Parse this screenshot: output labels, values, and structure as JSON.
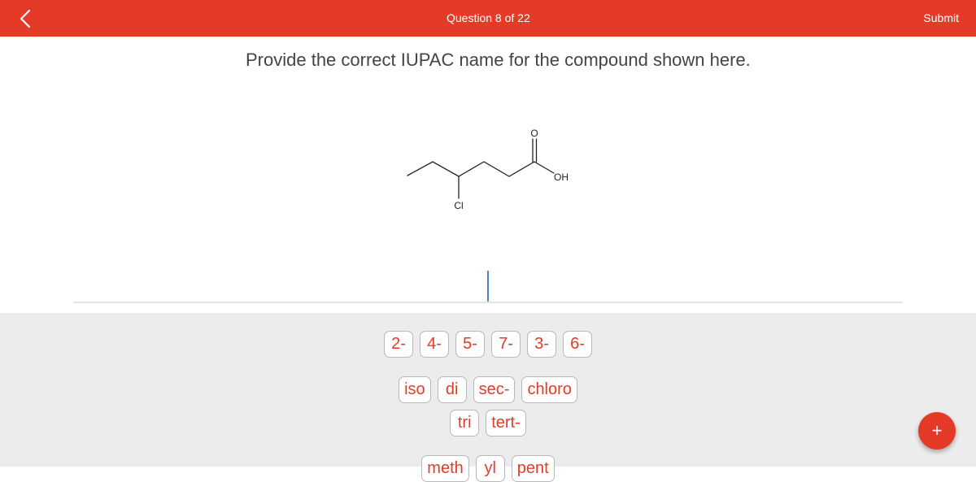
{
  "header": {
    "back_icon": "chevron-left-icon",
    "title": "Question 8 of 22",
    "submit_label": "Submit",
    "color": "#e53a28"
  },
  "question": {
    "prompt": "Provide the correct IUPAC name for the compound shown here.",
    "structure": {
      "description": "4-chlorohexanoic acid skeletal formula",
      "labels": {
        "carbonyl_oxygen": "O",
        "hydroxyl": "OH",
        "substituent": "Cl"
      }
    }
  },
  "answer": {
    "value": ""
  },
  "keyboard": {
    "rows": [
      [
        "2-",
        "4-",
        "5-",
        "7-",
        "3-",
        "6-"
      ],
      [
        "iso",
        "di",
        "sec-",
        "chloro"
      ],
      [
        "tri",
        "tert-"
      ],
      [
        "meth",
        "yl",
        "pent"
      ]
    ]
  },
  "fab": {
    "label": "+",
    "icon": "plus-icon"
  }
}
